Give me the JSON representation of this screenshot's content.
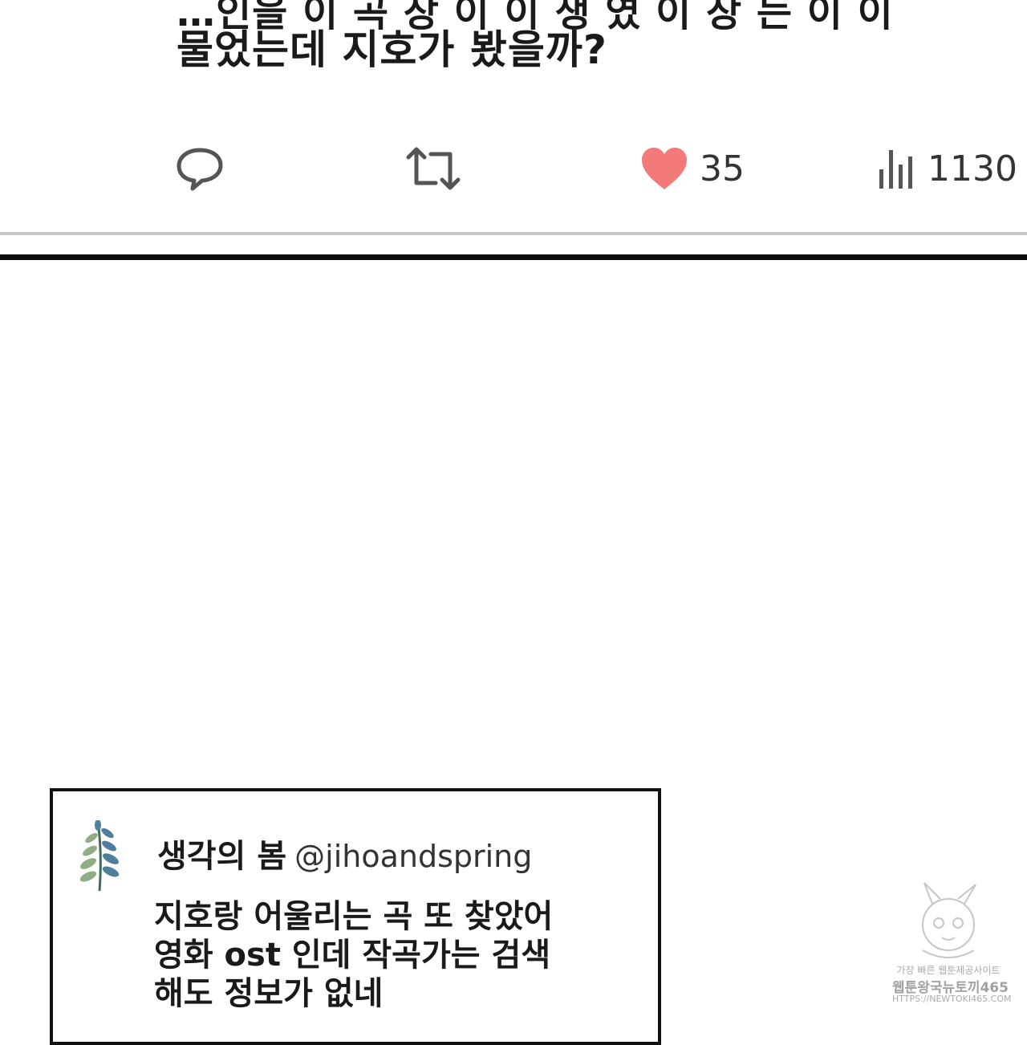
{
  "post": {
    "partial_line": "…인을 이 곡 장 이 이 생 였 이 장 는 이 이",
    "text": "물었는데 지호가 봤을까?"
  },
  "actions": {
    "reply_icon": "reply-icon",
    "retweet_icon": "retweet-icon",
    "like_icon": "heart-icon",
    "like_count": "35",
    "like_color": "#f47a7a",
    "views_icon": "bar-chart-icon",
    "view_count": "1130"
  },
  "tweet": {
    "avatar_icon": "leaf-branch-icon",
    "name": "생각의 봄",
    "handle": "@jihoandspring",
    "lines": [
      "지호랑 어울리는 곡 또 찾았어",
      "영화 ost 인데 작곡가는 검색",
      "해도 정보가 없네"
    ]
  },
  "watermark": {
    "line1": "가장 빠른 웹툰제공사이트",
    "line2": "웹툰왕국뉴토끼465",
    "line3": "HTTPS://NEWTOKI465.COM"
  }
}
